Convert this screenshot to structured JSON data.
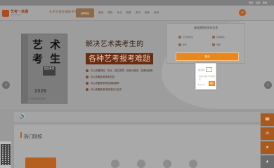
{
  "topbar": {
    "links": [
      "登录",
      "注册",
      "帮助"
    ]
  },
  "header": {
    "logo_name": "艺考一点通",
    "logo_sub": "www.ykt.com",
    "slogan": "艺术生报考辅助平台",
    "city_label": "选择地区",
    "nav": [
      "首页",
      "院校",
      "专业",
      "政策",
      "资讯",
      "报考",
      "我的"
    ],
    "avatar_glyph": "☺"
  },
  "banner": {
    "book_chars": [
      "艺",
      "术",
      "考",
      "生"
    ],
    "book_badge": "招生考试",
    "book_year": "2026",
    "book_footer": "艺术类考生报考指南",
    "headline1": "解决艺术类考生的",
    "headline2": "各种艺考报考难题",
    "bullets": [
      "可以查看院校、专业、招生简章、统考分数线、校考信息等",
      "可以查看高考报考志愿",
      "可以查看报考院校录取概率",
      "可以查看统考成绩排名与位次"
    ],
    "arrow_left": "‹",
    "arrow_right": "›"
  },
  "login_panel": {
    "title": "请选择您的身份信息",
    "options": [
      "艺术类考生",
      "普通考生",
      "家长",
      "老师"
    ],
    "submit_label": "提交"
  },
  "qr_popup": {
    "label": "验证码",
    "code_value": "",
    "message": "请输入图片中的验证码",
    "captcha": "• • ○",
    "ok_label": "确定"
  },
  "notice": {
    "speaker_icon": "🔊",
    "text": ""
  },
  "section": {
    "title": "热门院校"
  },
  "side_tools": [
    "☎",
    "✉",
    "★",
    "▲"
  ],
  "colors": {
    "accent": "#e9861c",
    "brand": "#b5601f"
  }
}
